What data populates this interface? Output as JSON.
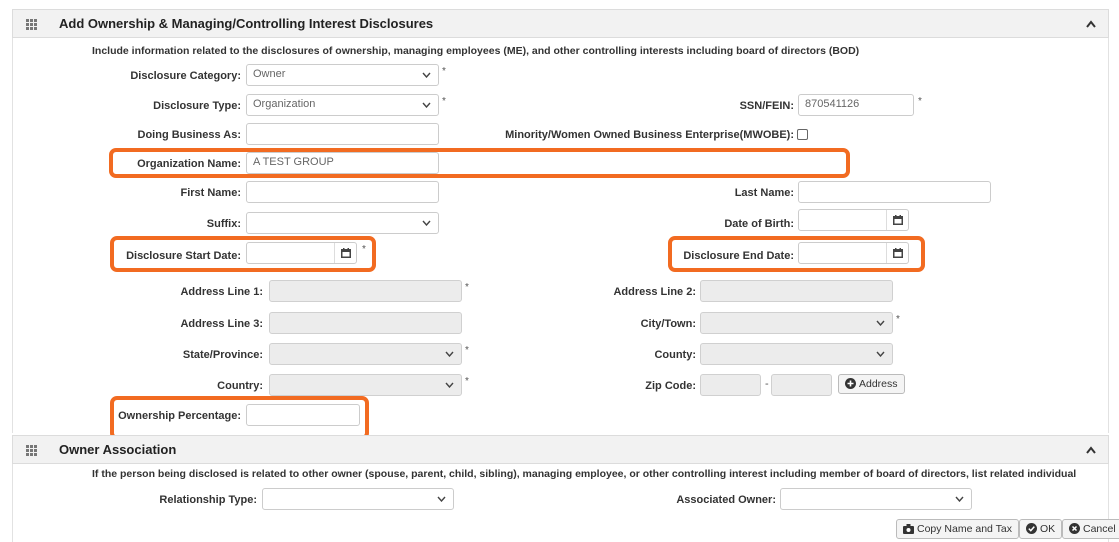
{
  "section1": {
    "title": "Add Ownership & Managing/Controlling Interest Disclosures",
    "intro": "Include information related to the disclosures of ownership, managing employees (ME), and other controlling interests including board of directors (BOD)"
  },
  "fields": {
    "disclosure_category": {
      "label": "Disclosure Category:",
      "value": "Owner"
    },
    "disclosure_type": {
      "label": "Disclosure Type:",
      "value": "Organization"
    },
    "ssn_fein": {
      "label": "SSN/FEIN:",
      "value": "870541126"
    },
    "doing_business_as": {
      "label": "Doing Business As:",
      "value": ""
    },
    "mwobe": {
      "label": "Minority/Women Owned Business Enterprise(MWOBE):"
    },
    "organization_name": {
      "label": "Organization Name:",
      "value": "A TEST GROUP"
    },
    "first_name": {
      "label": "First Name:",
      "value": ""
    },
    "last_name": {
      "label": "Last Name:",
      "value": ""
    },
    "suffix": {
      "label": "Suffix:",
      "value": ""
    },
    "date_of_birth": {
      "label": "Date of Birth:",
      "value": ""
    },
    "disclosure_start_date": {
      "label": "Disclosure Start Date:",
      "value": ""
    },
    "disclosure_end_date": {
      "label": "Disclosure End Date:",
      "value": ""
    },
    "address_line_1": {
      "label": "Address Line 1:",
      "value": ""
    },
    "address_line_2": {
      "label": "Address Line 2:",
      "value": ""
    },
    "address_line_3": {
      "label": "Address Line 3:",
      "value": ""
    },
    "city_town": {
      "label": "City/Town:",
      "value": ""
    },
    "state_province": {
      "label": "State/Province:",
      "value": ""
    },
    "county": {
      "label": "County:",
      "value": ""
    },
    "country": {
      "label": "Country:",
      "value": ""
    },
    "zip_code": {
      "label": "Zip Code:",
      "value": "",
      "separator": "-"
    },
    "address_button": "Address",
    "ownership_percentage": {
      "label": "Ownership Percentage:",
      "value": ""
    }
  },
  "section2": {
    "title": "Owner Association",
    "intro": "If the person being disclosed is related to other owner (spouse, parent, child, sibling), managing employee, or other controlling interest including member of board of directors, list related individual",
    "relationship_type": {
      "label": "Relationship Type:",
      "value": ""
    },
    "associated_owner": {
      "label": "Associated Owner:",
      "value": ""
    }
  },
  "actions": {
    "copy_name_tax": "Copy Name and Tax",
    "ok": "OK",
    "cancel": "Cancel"
  },
  "required_mark": "*",
  "colors": {
    "highlight": "#f26b21",
    "header_bg": "#f2f2f2",
    "disabled_bg": "#ececec"
  },
  "icons": [
    "grid-icon",
    "chevron-up-icon",
    "chevron-down-icon",
    "calendar-icon",
    "plus-circle-icon",
    "camera-icon",
    "check-circle-icon",
    "close-circle-icon"
  ]
}
